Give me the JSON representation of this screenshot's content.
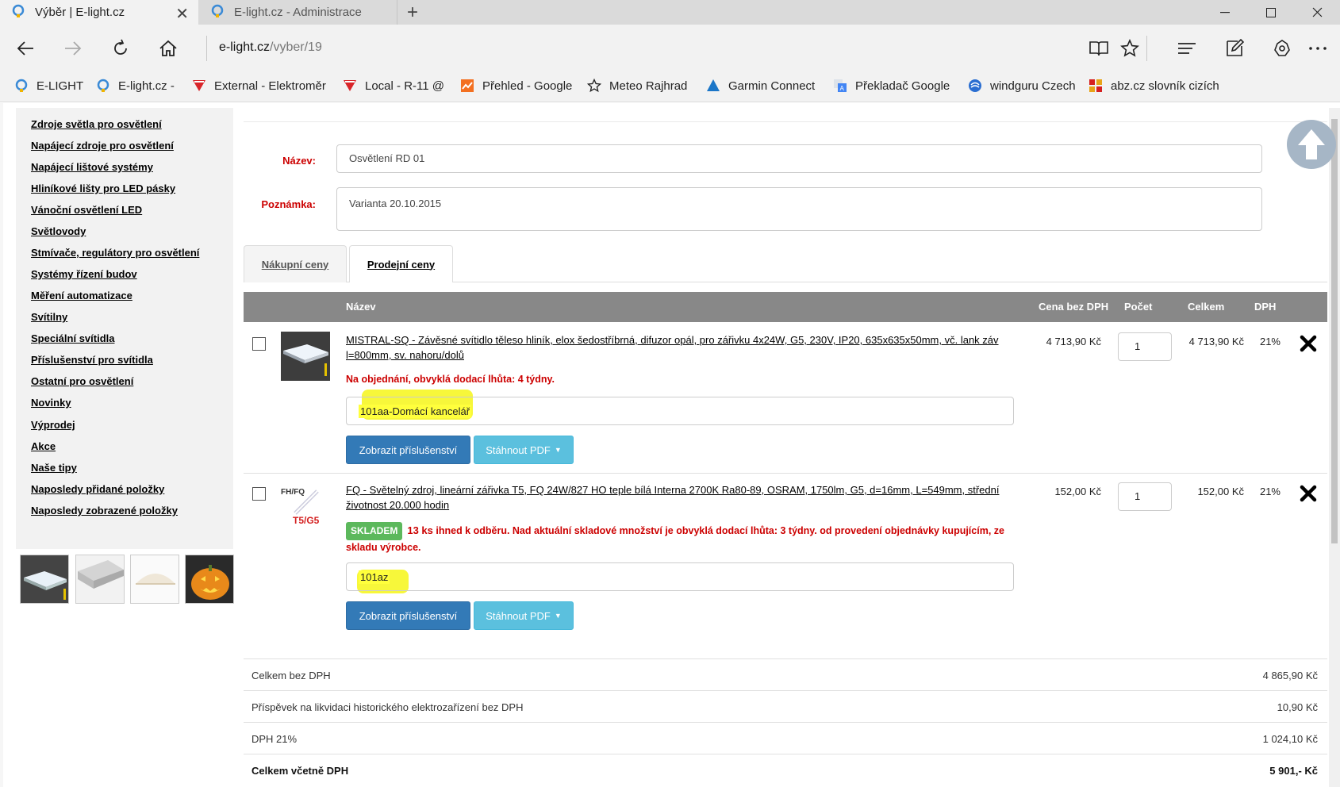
{
  "browser": {
    "tabs": [
      {
        "title": "Výběr | E-light.cz",
        "active": true
      },
      {
        "title": "E-light.cz - Administrace",
        "active": false
      }
    ],
    "address": {
      "domain": "e-light.cz",
      "path": "/vyber/19"
    },
    "favorites": [
      {
        "label": "E-LIGHT",
        "icon": "e-light-favicon"
      },
      {
        "label": "E-light.cz -",
        "icon": "e-light-favicon"
      },
      {
        "label": "External - Elektroměr",
        "icon": "elektromer-favicon"
      },
      {
        "label": "Local - R-11 @",
        "icon": "elektromer-favicon"
      },
      {
        "label": "Přehled - Google",
        "icon": "google-analytics-favicon"
      },
      {
        "label": "Meteo Rajhrad",
        "icon": "star-icon"
      },
      {
        "label": "Garmin Connect",
        "icon": "garmin-triangle-icon"
      },
      {
        "label": "Překladač Google",
        "icon": "google-translate-icon"
      },
      {
        "label": "windguru Czech",
        "icon": "windguru-icon"
      },
      {
        "label": "abz.cz slovník cizích",
        "icon": "abz-favicon"
      }
    ]
  },
  "sidebar": {
    "items": [
      "Zdroje světla pro osvětlení",
      "Napájecí zdroje pro osvětlení",
      "Napájecí lištové systémy",
      "Hliníkové lišty pro LED pásky",
      "Vánoční osvětlení LED",
      "Světlovody",
      "Stmívače, regulátory pro osvětlení",
      "Systémy řízení budov",
      "Měření automatizace",
      "Svítilny",
      "Speciální svítidla",
      "Příslušenství pro svítidla",
      "Ostatní pro osvětlení",
      "Novinky",
      "Výprodej",
      "Akce",
      "Naše tipy",
      "Naposledy přidané položky",
      "Naposledy zobrazené položky"
    ]
  },
  "form": {
    "name_label": "Název:",
    "name_value": "Osvětlení RD 01",
    "note_label": "Poznámka:",
    "note_value": "Varianta 20.10.2015"
  },
  "price_tabs": {
    "purchase": "Nákupní ceny",
    "sale": "Prodejní ceny"
  },
  "table": {
    "headers": {
      "name": "Název",
      "price_ex_vat": "Cena bez DPH",
      "count": "Počet",
      "total": "Celkem",
      "vat": "DPH"
    },
    "rows": [
      {
        "name": "MISTRAL-SQ - Závěsné svítidlo těleso hliník, elox šedostříbrná, difuzor opál, pro zářivku 4x24W, G5, 230V, IP20, 635x635x50mm, vč. lank záv l=800mm, sv. nahoru/dolů",
        "availability": "Na objednání, obvyklá dodací lhůta: 4 týdny.",
        "room": "101aa-Domácí kancelář",
        "btn_accessories": "Zobrazit příslušenství",
        "btn_pdf": "Stáhnout PDF",
        "price": "4 713,90 Kč",
        "qty": "1",
        "total": "4 713,90 Kč",
        "vat": "21%"
      },
      {
        "name": "FQ - Světelný zdroj, lineární zářivka T5, FQ 24W/827 HO teple bílá Interna 2700K Ra80-89, OSRAM, 1750lm, G5, d=16mm, L=549mm, střední životnost 20.000 hodin",
        "image_label_top": "FH/FQ",
        "image_label_bottom": "T5/G5",
        "stock_badge": "SKLADEM",
        "stock_qty": "13 ks",
        "availability": "ihned k odběru. Nad aktuální skladové množství je obvyklá dodací lhůta: 3 týdny. od provedení objednávky kupujícím, ze skladu výrobce.",
        "room": "101az",
        "btn_accessories": "Zobrazit příslušenství",
        "btn_pdf": "Stáhnout PDF",
        "price": "152,00 Kč",
        "qty": "1",
        "total": "152,00 Kč",
        "vat": "21%"
      }
    ]
  },
  "summary": [
    {
      "label": "Celkem bez DPH",
      "value": "4 865,90 Kč",
      "bold": false
    },
    {
      "label": "Příspěvek na likvidaci historického elektrozařízení bez DPH",
      "value": "10,90 Kč",
      "bold": false
    },
    {
      "label": "DPH 21%",
      "value": "1 024,10 Kč",
      "bold": false
    },
    {
      "label": "Celkem včetně DPH",
      "value": "5 901,- Kč",
      "bold": true
    }
  ],
  "colors": {
    "accent_red": "#cc0000",
    "header_gray": "#888888",
    "primary_blue": "#337ab7",
    "info_blue": "#5bc0de",
    "stock_green": "#5cb85c",
    "highlight_yellow": "#ffff3c"
  }
}
